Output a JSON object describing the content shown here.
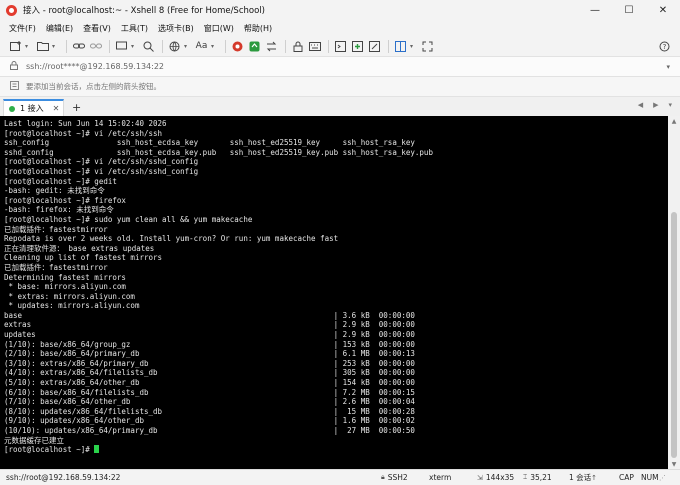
{
  "window": {
    "title": "接入 - root@localhost:~ - Xshell 8 (Free for Home/School)",
    "minimize": "—",
    "maximize": "☐",
    "close": "✕"
  },
  "menu": [
    "文件(F)",
    "编辑(E)",
    "查看(V)",
    "工具(T)",
    "选项卡(B)",
    "窗口(W)",
    "帮助(H)"
  ],
  "toolbar": {
    "icons": [
      "new-session-icon",
      "open-icon",
      "link-icon",
      "unlink-icon",
      "reconnect-icon",
      "search-icon",
      "globe-icon",
      "font-icon",
      "xshell-icon",
      "xftp-icon",
      "transfer-icon",
      "lock-icon",
      "keyboard-icon",
      "script-icon",
      "add-icon",
      "compose-icon",
      "layout-icon",
      "fullscreen-icon",
      "help-icon"
    ],
    "font_label": "Aa"
  },
  "address": {
    "value": "ssh://root****@192.168.59.134:22"
  },
  "hint": {
    "text": "要添加当前会话，点击左侧的箭头按钮。"
  },
  "tabs": [
    {
      "label": "1 接入",
      "active": true,
      "status_color": "#2fae4a"
    }
  ],
  "terminal": {
    "lines": [
      "Last login: Sun Jun 14 15:02:40 2026",
      "[root@localhost ~]# vi /etc/ssh/ssh",
      "ssh_config               ssh_host_ecdsa_key       ssh_host_ed25519_key     ssh_host_rsa_key",
      "sshd_config              ssh_host_ecdsa_key.pub   ssh_host_ed25519_key.pub ssh_host_rsa_key.pub",
      "[root@localhost ~]# vi /etc/ssh/sshd_config",
      "[root@localhost ~]# vi /etc/ssh/sshd_config",
      "[root@localhost ~]# gedit",
      "-bash: gedit: 未找到命令",
      "[root@localhost ~]# firefox",
      "-bash: firefox: 未找到命令",
      "[root@localhost ~]# sudo yum clean all && yum makecache",
      "已加载插件：fastestmirror",
      "Repodata is over 2 weeks old. Install yum-cron? Or run: yum makecache fast",
      "正在清理软件源： base extras updates",
      "Cleaning up list of fastest mirrors",
      "已加载插件：fastestmirror",
      "Determining fastest mirrors",
      " * base: mirrors.aliyun.com",
      " * extras: mirrors.aliyun.com",
      " * updates: mirrors.aliyun.com",
      "base                                                                     | 3.6 kB  00:00:00",
      "extras                                                                   | 2.9 kB  00:00:00",
      "updates                                                                  | 2.9 kB  00:00:00",
      "(1/10): base/x86_64/group_gz                                             | 153 kB  00:00:00",
      "(2/10): base/x86_64/primary_db                                           | 6.1 MB  00:00:13",
      "(3/10): extras/x86_64/primary_db                                         | 253 kB  00:00:00",
      "(4/10): extras/x86_64/filelists_db                                       | 305 kB  00:00:00",
      "(5/10): extras/x86_64/other_db                                           | 154 kB  00:00:00",
      "(6/10): base/x86_64/filelists_db                                         | 7.2 MB  00:00:15",
      "(7/10): base/x86_64/other_db                                             | 2.6 MB  00:00:04",
      "(8/10): updates/x86_64/filelists_db                                      |  15 MB  00:00:28",
      "(9/10): updates/x86_64/other_db                                          | 1.6 MB  00:00:02",
      "(10/10): updates/x86_64/primary_db                                       |  27 MB  00:00:50",
      "元数据缓存已建立"
    ],
    "prompt": "[root@localhost ~]# ",
    "cursor_color": "#2ad24b"
  },
  "status": {
    "connection": "ssh://root@192.168.59.134:22",
    "protocol": "SSH2",
    "terminal_type": "xterm",
    "size": "144x35",
    "position": "35,21",
    "sessions": "1 会话",
    "caps": "CAP",
    "num": "NUM"
  }
}
